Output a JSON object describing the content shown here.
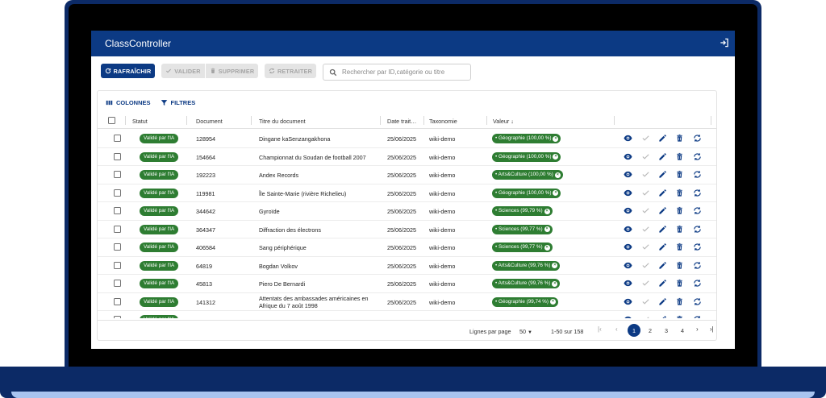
{
  "app": {
    "title": "ClassController"
  },
  "toolbar": {
    "refresh_label": "RAFRAÎCHIR",
    "validate_label": "VALIDER",
    "delete_label": "SUPPRIMER",
    "reprocess_label": "RETRAITER",
    "search_placeholder": "Rechercher par ID,catégorie ou titre"
  },
  "grid_tools": {
    "columns_label": "COLONNES",
    "filters_label": "FILTRES"
  },
  "columns": {
    "status": "Statut",
    "document": "Document",
    "title": "Titre du document",
    "date": "Date trait…",
    "taxonomy": "Taxonomie",
    "value": "Valeur ↓"
  },
  "rows": [
    {
      "status": "Validé par l'IA",
      "document": "128954",
      "title": "Dingane kaSenzangakhona",
      "date": "25/06/2025",
      "taxonomy": "wiki-demo",
      "value": "• Géographie (100,00 %)"
    },
    {
      "status": "Validé par l'IA",
      "document": "154664",
      "title": "Championnat du Soudan de football 2007",
      "date": "25/06/2025",
      "taxonomy": "wiki-demo",
      "value": "• Géographie (100,00 %)"
    },
    {
      "status": "Validé par l'IA",
      "document": "192223",
      "title": "Andex Records",
      "date": "25/06/2025",
      "taxonomy": "wiki-demo",
      "value": "• Arts&Culture (100,00 %)"
    },
    {
      "status": "Validé par l'IA",
      "document": "119981",
      "title": "Île Sainte-Marie (rivière Richelieu)",
      "date": "25/06/2025",
      "taxonomy": "wiki-demo",
      "value": "• Géographie (100,00 %)"
    },
    {
      "status": "Validé par l'IA",
      "document": "344642",
      "title": "Gyroïde",
      "date": "25/06/2025",
      "taxonomy": "wiki-demo",
      "value": "• Sciences (99,79 %)"
    },
    {
      "status": "Validé par l'IA",
      "document": "364347",
      "title": "Diffraction des électrons",
      "date": "25/06/2025",
      "taxonomy": "wiki-demo",
      "value": "• Sciences (99,77 %)"
    },
    {
      "status": "Validé par l'IA",
      "document": "406584",
      "title": "Sang périphérique",
      "date": "25/06/2025",
      "taxonomy": "wiki-demo",
      "value": "• Sciences (99,77 %)"
    },
    {
      "status": "Validé par l'IA",
      "document": "64819",
      "title": "Bogdan Volkov",
      "date": "25/06/2025",
      "taxonomy": "wiki-demo",
      "value": "• Arts&Culture (99,76 %)"
    },
    {
      "status": "Validé par l'IA",
      "document": "45813",
      "title": "Piero De Bernardi",
      "date": "25/06/2025",
      "taxonomy": "wiki-demo",
      "value": "• Arts&Culture (99,76 %)"
    },
    {
      "status": "Validé par l'IA",
      "document": "141312",
      "title": "Attentats des ambassades américaines en Afrique du 7 août 1998",
      "date": "25/06/2025",
      "taxonomy": "wiki-demo",
      "value": "• Géographie (99,74 %)"
    },
    {
      "status": "Validé par l'IA",
      "document": "",
      "title": "",
      "date": "",
      "taxonomy": "",
      "value": ""
    }
  ],
  "footer": {
    "rows_per_page_label": "Lignes par page",
    "rows_per_page_value": "50",
    "range_label": "1-50 sur 158",
    "pages": [
      "1",
      "2",
      "3",
      "4"
    ],
    "current_page": "1"
  },
  "colors": {
    "brand": "#0c3a84",
    "status_green": "#2e7d32",
    "frame": "#0c2a66"
  }
}
